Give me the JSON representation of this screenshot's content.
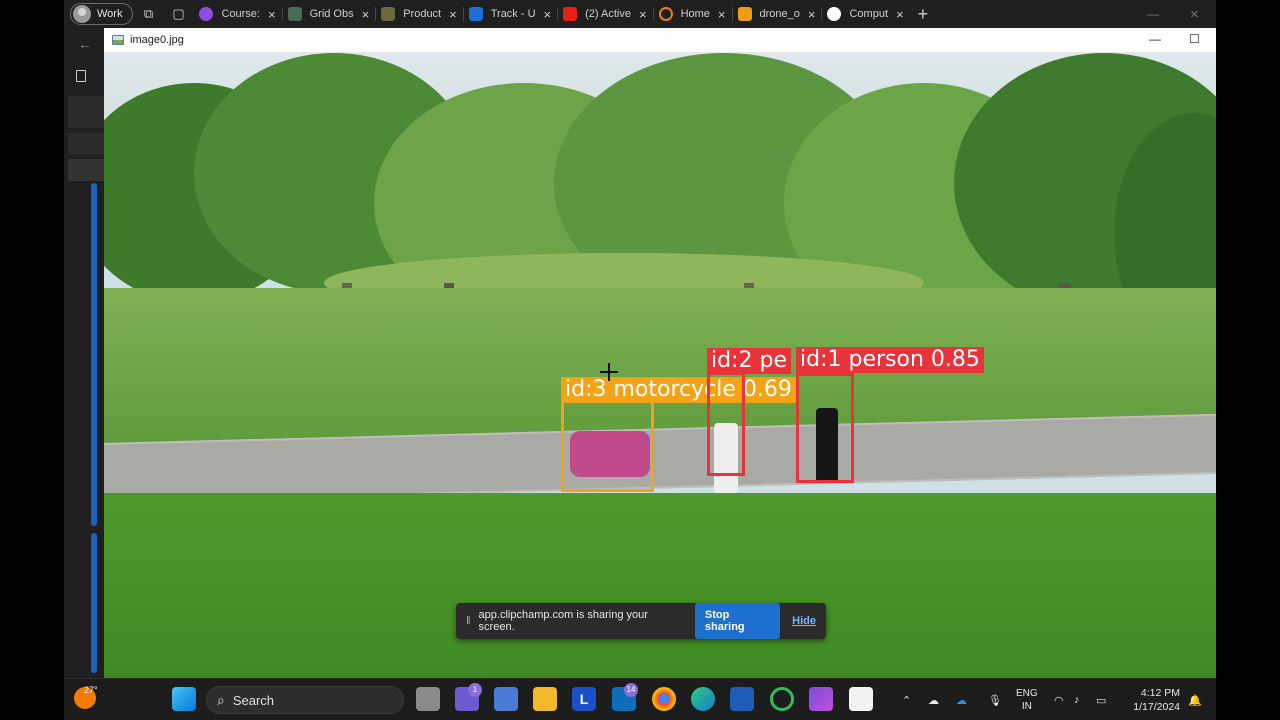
{
  "browser": {
    "profile_label": "Work",
    "tabs": [
      {
        "label": "Course:",
        "icon": "udemy-icon",
        "color": "#8b4fe0"
      },
      {
        "label": "Grid Obs",
        "icon": "grid-icon",
        "color": "#4a6a58"
      },
      {
        "label": "Product",
        "icon": "product-icon",
        "color": "#6a6a3a"
      },
      {
        "label": "Track - U",
        "icon": "track-icon",
        "color": "#1b6fd8"
      },
      {
        "label": "(2) Active",
        "icon": "youtube-icon",
        "color": "#e62117"
      },
      {
        "label": "Home",
        "icon": "home-icon",
        "color": "#ef7d22"
      },
      {
        "label": "drone_o",
        "icon": "hourglass-icon",
        "color": "#f39c12"
      },
      {
        "label": "Comput",
        "icon": "github-icon",
        "color": "#ffffff"
      }
    ]
  },
  "viewer": {
    "title": "image0.jpg",
    "minimize": "—",
    "maximize": "☐"
  },
  "detections": [
    {
      "label": "id:3  motorcycle  0.69",
      "color": "#f5a316"
    },
    {
      "label": "id:2  pe",
      "color": "#e8333a"
    },
    {
      "label": "id:1  person  0.85",
      "color": "#e8333a"
    }
  ],
  "share_bar": {
    "message": "app.clipchamp.com is sharing your screen.",
    "stop_label": "Stop sharing",
    "hide_label": "Hide"
  },
  "taskbar": {
    "weather_temp": "27°",
    "search_label": "Search",
    "badges": {
      "teams": "1",
      "outlook": "14"
    },
    "lang_top": "ENG",
    "lang_bottom": "IN",
    "time": "4:12 PM",
    "date": "1/17/2024"
  }
}
